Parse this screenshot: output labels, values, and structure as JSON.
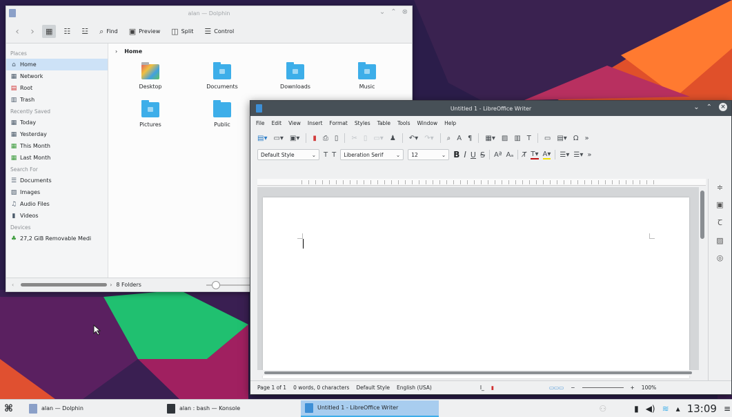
{
  "dolphin": {
    "title": "alan — Dolphin",
    "toolbar": {
      "find": "Find",
      "preview": "Preview",
      "split": "Split",
      "control": "Control"
    },
    "places": {
      "places_heading": "Places",
      "items": [
        "Home",
        "Network",
        "Root",
        "Trash"
      ],
      "recent_heading": "Recently Saved",
      "recent": [
        "Today",
        "Yesterday",
        "This Month",
        "Last Month"
      ],
      "search_heading": "Search For",
      "search": [
        "Documents",
        "Images",
        "Audio Files",
        "Videos"
      ],
      "devices_heading": "Devices",
      "devices": [
        "27,2 GiB Removable Medi"
      ]
    },
    "breadcrumb": "Home",
    "files": [
      "Desktop",
      "Documents",
      "Downloads",
      "Music",
      "Pictures",
      "Public"
    ],
    "status": "8 Folders"
  },
  "writer": {
    "title": "Untitled 1 - LibreOffice Writer",
    "menu": [
      "File",
      "Edit",
      "View",
      "Insert",
      "Format",
      "Styles",
      "Table",
      "Tools",
      "Window",
      "Help"
    ],
    "paragraph_style": "Default Style",
    "font_name": "Liberation Serif",
    "font_size": "12",
    "status": {
      "page": "Page 1 of 1",
      "words": "0 words, 0 characters",
      "style": "Default Style",
      "language": "English (USA)",
      "zoom": "100%"
    }
  },
  "taskbar": {
    "tasks": [
      "alan — Dolphin",
      "alan : bash — Konsole",
      "Untitled 1 - LibreOffice Writer"
    ],
    "clock": "13:09"
  }
}
